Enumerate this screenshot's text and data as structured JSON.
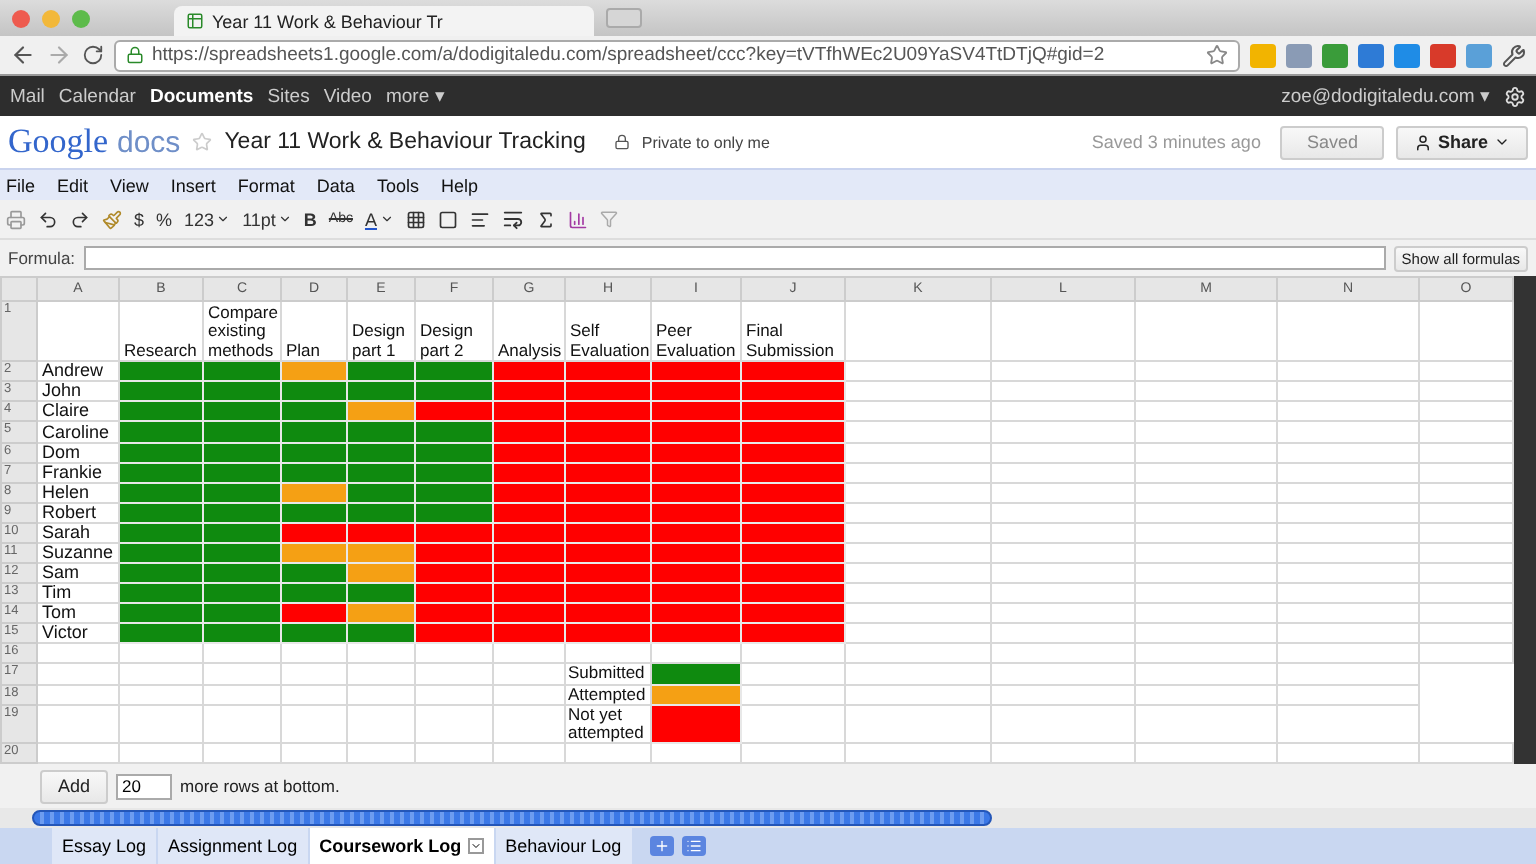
{
  "browser": {
    "tab_title": "Year 11 Work & Behaviour Tr",
    "url": "https://spreadsheets1.google.com/a/dodigitaledu.com/spreadsheet/ccc?key=tVTfhWEc2U09YaSV4TtDTjQ#gid=2"
  },
  "google_bar": {
    "links": [
      {
        "label": "Mail",
        "selected": false
      },
      {
        "label": "Calendar",
        "selected": false
      },
      {
        "label": "Documents",
        "selected": true
      },
      {
        "label": "Sites",
        "selected": false
      },
      {
        "label": "Video",
        "selected": false
      },
      {
        "label": "more ▾",
        "selected": false
      }
    ],
    "account": "zoe@dodigitaledu.com ▾"
  },
  "doc_header": {
    "logo_word": "Google",
    "logo_product": "docs",
    "title": "Year 11 Work & Behaviour Tracking",
    "privacy": "Private to only me",
    "save_status": "Saved 3 minutes ago",
    "saved_button": "Saved",
    "share_button": "Share"
  },
  "menu": [
    "File",
    "Edit",
    "View",
    "Insert",
    "Format",
    "Data",
    "Tools",
    "Help"
  ],
  "toolbar": {
    "currency": "$",
    "percent": "%",
    "number_format": "123",
    "font_size": "11pt",
    "bold": "B",
    "strikethrough": "Abc",
    "text_color": "A"
  },
  "formula_bar": {
    "label": "Formula:",
    "button": "Show all formulas"
  },
  "sheet": {
    "columns": [
      "A",
      "B",
      "C",
      "D",
      "E",
      "F",
      "G",
      "H",
      "I",
      "J",
      "K",
      "L",
      "M",
      "N",
      "O"
    ],
    "rows": [
      {
        "number": "1",
        "kind": "header",
        "headings": [
          "Research",
          "Compare existing methods",
          "Plan",
          "Design part 1",
          "Design part 2",
          "Analysis",
          "Self Evaluation",
          "Peer Evaluation",
          "Final Submission"
        ]
      },
      {
        "number": "2",
        "kind": "student",
        "name": "Andrew",
        "cells": [
          {
            "color": "#0f8a0f"
          },
          {
            "color": "#0f8a0f"
          },
          {
            "color": "#f5a014"
          },
          {
            "color": "#0f8a0f"
          },
          {
            "color": "#0f8a0f"
          },
          {
            "color": "#ff0000"
          },
          {
            "color": "#ff0000"
          },
          {
            "color": "#ff0000"
          },
          {
            "color": "#ff0000"
          }
        ]
      },
      {
        "number": "3",
        "kind": "student",
        "name": "John",
        "cells": [
          {
            "color": "#0f8a0f"
          },
          {
            "color": "#0f8a0f"
          },
          {
            "color": "#0f8a0f"
          },
          {
            "color": "#0f8a0f"
          },
          {
            "color": "#0f8a0f"
          },
          {
            "color": "#ff0000"
          },
          {
            "color": "#ff0000"
          },
          {
            "color": "#ff0000"
          },
          {
            "color": "#ff0000"
          }
        ]
      },
      {
        "number": "4",
        "kind": "student",
        "name": "Claire",
        "cells": [
          {
            "color": "#0f8a0f"
          },
          {
            "color": "#0f8a0f"
          },
          {
            "color": "#0f8a0f"
          },
          {
            "color": "#f5a014"
          },
          {
            "color": "#ff0000"
          },
          {
            "color": "#ff0000"
          },
          {
            "color": "#ff0000"
          },
          {
            "color": "#ff0000"
          },
          {
            "color": "#ff0000"
          }
        ]
      },
      {
        "number": "5",
        "kind": "student",
        "name": "Caroline",
        "cells": [
          {
            "color": "#0f8a0f"
          },
          {
            "color": "#0f8a0f"
          },
          {
            "color": "#0f8a0f"
          },
          {
            "color": "#0f8a0f"
          },
          {
            "color": "#0f8a0f"
          },
          {
            "color": "#ff0000"
          },
          {
            "color": "#ff0000"
          },
          {
            "color": "#ff0000"
          },
          {
            "color": "#ff0000"
          }
        ]
      },
      {
        "number": "6",
        "kind": "student",
        "name": "Dom",
        "cells": [
          {
            "color": "#0f8a0f"
          },
          {
            "color": "#0f8a0f"
          },
          {
            "color": "#0f8a0f"
          },
          {
            "color": "#0f8a0f"
          },
          {
            "color": "#0f8a0f"
          },
          {
            "color": "#ff0000"
          },
          {
            "color": "#ff0000"
          },
          {
            "color": "#ff0000"
          },
          {
            "color": "#ff0000"
          }
        ]
      },
      {
        "number": "7",
        "kind": "student",
        "name": "Frankie",
        "cells": [
          {
            "color": "#0f8a0f"
          },
          {
            "color": "#0f8a0f"
          },
          {
            "color": "#0f8a0f"
          },
          {
            "color": "#0f8a0f"
          },
          {
            "color": "#0f8a0f"
          },
          {
            "color": "#ff0000"
          },
          {
            "color": "#ff0000"
          },
          {
            "color": "#ff0000"
          },
          {
            "color": "#ff0000"
          }
        ]
      },
      {
        "number": "8",
        "kind": "student",
        "name": "Helen",
        "cells": [
          {
            "color": "#0f8a0f"
          },
          {
            "color": "#0f8a0f"
          },
          {
            "color": "#f5a014"
          },
          {
            "color": "#0f8a0f"
          },
          {
            "color": "#0f8a0f"
          },
          {
            "color": "#ff0000"
          },
          {
            "color": "#ff0000"
          },
          {
            "color": "#ff0000"
          },
          {
            "color": "#ff0000"
          }
        ]
      },
      {
        "number": "9",
        "kind": "student",
        "name": "Robert",
        "cells": [
          {
            "color": "#0f8a0f"
          },
          {
            "color": "#0f8a0f"
          },
          {
            "color": "#0f8a0f"
          },
          {
            "color": "#0f8a0f"
          },
          {
            "color": "#0f8a0f"
          },
          {
            "color": "#ff0000"
          },
          {
            "color": "#ff0000"
          },
          {
            "color": "#ff0000"
          },
          {
            "color": "#ff0000"
          }
        ]
      },
      {
        "number": "10",
        "kind": "student",
        "name": "Sarah",
        "cells": [
          {
            "color": "#0f8a0f"
          },
          {
            "color": "#0f8a0f"
          },
          {
            "color": "#ff0000"
          },
          {
            "color": "#ff0000"
          },
          {
            "color": "#ff0000"
          },
          {
            "color": "#ff0000"
          },
          {
            "color": "#ff0000"
          },
          {
            "color": "#ff0000"
          },
          {
            "color": "#ff0000"
          }
        ]
      },
      {
        "number": "11",
        "kind": "student",
        "name": "Suzanne",
        "cells": [
          {
            "color": "#0f8a0f"
          },
          {
            "color": "#0f8a0f"
          },
          {
            "color": "#f5a014"
          },
          {
            "color": "#f5a014"
          },
          {
            "color": "#ff0000"
          },
          {
            "color": "#ff0000"
          },
          {
            "color": "#ff0000"
          },
          {
            "color": "#ff0000"
          },
          {
            "color": "#ff0000"
          }
        ]
      },
      {
        "number": "12",
        "kind": "student",
        "name": "Sam",
        "cells": [
          {
            "color": "#0f8a0f"
          },
          {
            "color": "#0f8a0f"
          },
          {
            "color": "#0f8a0f"
          },
          {
            "color": "#f5a014"
          },
          {
            "color": "#ff0000"
          },
          {
            "color": "#ff0000"
          },
          {
            "color": "#ff0000"
          },
          {
            "color": "#ff0000"
          },
          {
            "color": "#ff0000"
          }
        ]
      },
      {
        "number": "13",
        "kind": "student",
        "name": "Tim",
        "cells": [
          {
            "color": "#0f8a0f"
          },
          {
            "color": "#0f8a0f"
          },
          {
            "color": "#0f8a0f"
          },
          {
            "color": "#0f8a0f"
          },
          {
            "color": "#ff0000"
          },
          {
            "color": "#ff0000"
          },
          {
            "color": "#ff0000"
          },
          {
            "color": "#ff0000"
          },
          {
            "color": "#ff0000"
          }
        ]
      },
      {
        "number": "14",
        "kind": "student",
        "name": "Tom",
        "cells": [
          {
            "color": "#0f8a0f"
          },
          {
            "color": "#0f8a0f"
          },
          {
            "color": "#ff0000"
          },
          {
            "color": "#f5a014"
          },
          {
            "color": "#ff0000"
          },
          {
            "color": "#ff0000"
          },
          {
            "color": "#ff0000"
          },
          {
            "color": "#ff0000"
          },
          {
            "color": "#ff0000"
          }
        ]
      },
      {
        "number": "15",
        "kind": "student",
        "name": "Victor",
        "cells": [
          {
            "color": "#0f8a0f"
          },
          {
            "color": "#0f8a0f"
          },
          {
            "color": "#0f8a0f"
          },
          {
            "color": "#0f8a0f"
          },
          {
            "color": "#ff0000"
          },
          {
            "color": "#ff0000"
          },
          {
            "color": "#ff0000"
          },
          {
            "color": "#ff0000"
          },
          {
            "color": "#ff0000"
          }
        ]
      },
      {
        "number": "16",
        "kind": "blank"
      },
      {
        "number": "17",
        "kind": "legend",
        "label": "Submitted",
        "color": "#0f8a0f"
      },
      {
        "number": "18",
        "kind": "legend",
        "label": "Attempted",
        "color": "#f5a014"
      },
      {
        "number": "19",
        "kind": "legend",
        "label": "Not yet attempted",
        "color": "#ff0000"
      },
      {
        "number": "20",
        "kind": "blank"
      }
    ]
  },
  "add_rows": {
    "button": "Add",
    "value": "20",
    "suffix": "more rows at bottom."
  },
  "sheet_tabs": [
    {
      "label": "Essay Log",
      "selected": false
    },
    {
      "label": "Assignment Log",
      "selected": false
    },
    {
      "label": "Coursework Log",
      "selected": true
    },
    {
      "label": "Behaviour Log",
      "selected": false
    }
  ]
}
